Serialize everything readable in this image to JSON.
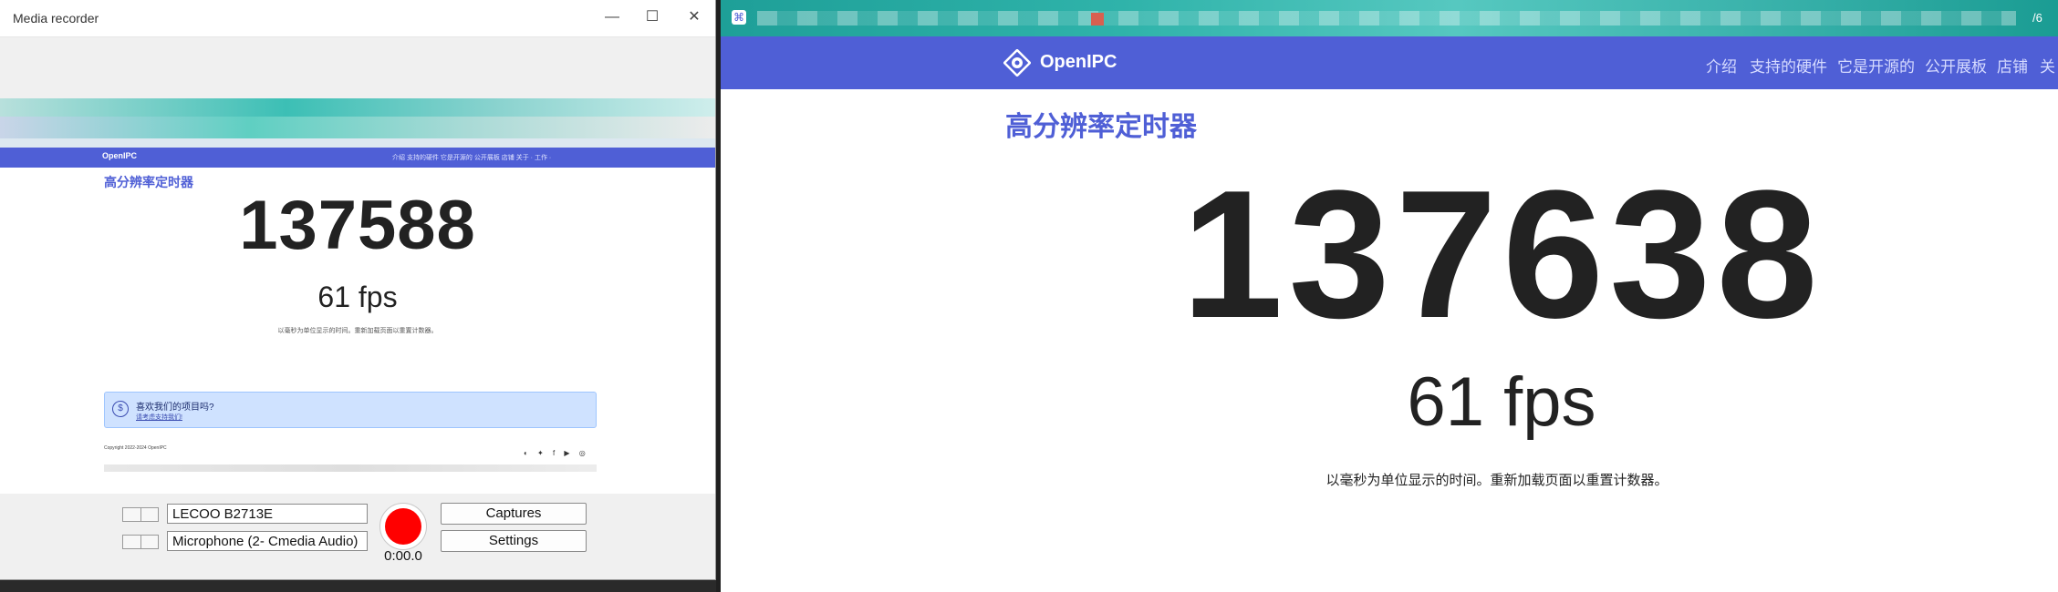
{
  "recorder": {
    "title": "Media recorder",
    "window_controls": [
      "—",
      "☐",
      "✕"
    ],
    "video_source": "LECOO B2713E",
    "audio_source": "Microphone (2- Cmedia Audio)",
    "captures_label": "Captures",
    "settings_label": "Settings",
    "timer": "0:00.0",
    "record_color": "#ff0000"
  },
  "preview": {
    "logo": "OpenIPC",
    "menu": "介绍   支持的硬件   它是开源的   公开展板   店铺   关于 ·   工作 ·",
    "heading": "高分辨率定时器",
    "counter": "137588",
    "fps": "61 fps",
    "description": "以毫秒为单位显示的时间。重新加载页面以重置计数器。",
    "alert_title": "喜欢我们的项目吗?",
    "alert_link": "请考虑支持我们!",
    "copyright": "Copyright 2022-2024 OpenIPC",
    "social": "◐ ✦ f ▶ ◎"
  },
  "browser": {
    "tab_favicon": "⌘",
    "tab_number": "/6",
    "nav": {
      "logo": "OpenIPC",
      "items": [
        "介绍",
        "支持的硬件",
        "它是开源的",
        "公开展板",
        "店铺",
        "关"
      ]
    },
    "heading": "高分辨率定时器",
    "counter": "137638",
    "fps": "61 fps",
    "description": "以毫秒为单位显示的时间。重新加载页面以重置计数器。"
  },
  "colors": {
    "brand": "#4f5fd6",
    "alert_bg": "#cfe2ff"
  }
}
